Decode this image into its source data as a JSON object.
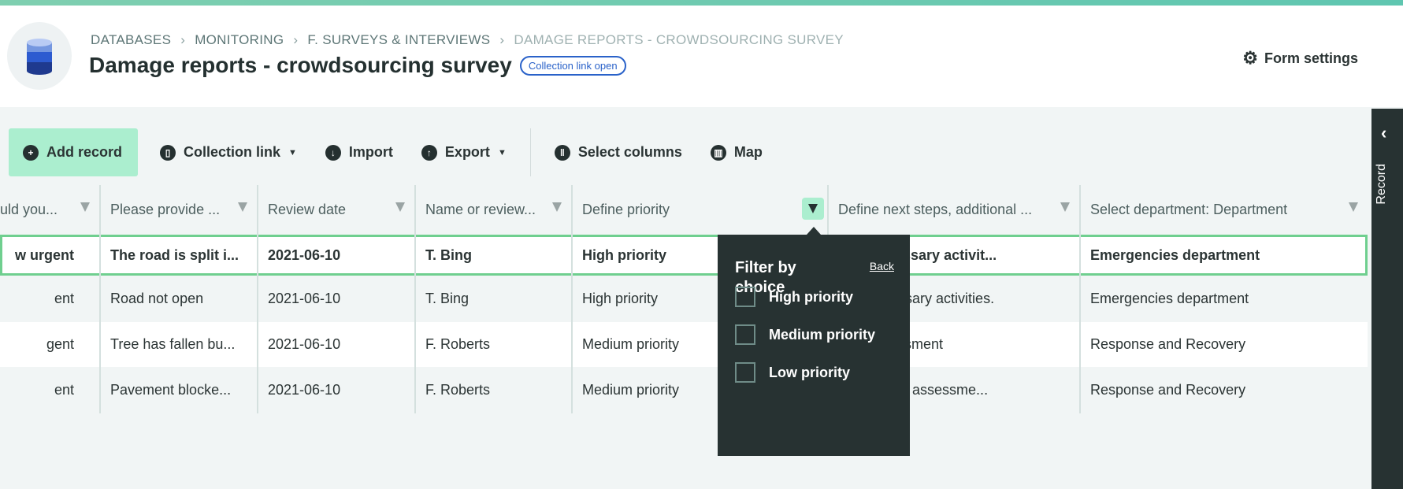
{
  "header": {
    "breadcrumbs": [
      "DATABASES",
      "MONITORING",
      "F. SURVEYS & INTERVIEWS",
      "DAMAGE REPORTS - CROWDSOURCING SURVEY"
    ],
    "title": "Damage reports - crowdsourcing survey",
    "badge": "Collection link open",
    "form_settings": "Form settings"
  },
  "toolbar": {
    "add_record": "Add record",
    "collection_link": "Collection link",
    "import": "Import",
    "export": "Export",
    "select_columns": "Select columns",
    "map": "Map"
  },
  "table": {
    "columns": [
      "uld you...",
      "Please provide ...",
      "Review date",
      "Name or review...",
      "Define priority",
      "Define next steps, additional ...",
      "Select department: Department"
    ],
    "rows": [
      [
        "w urgent",
        "The road is split i...",
        "2021-06-10",
        "T. Bing",
        "High priority",
        "with necessary activit...",
        "Emergencies department"
      ],
      [
        "ent",
        "Road not open",
        "2021-06-10",
        "T. Bing",
        "High priority",
        "with necessary activities.",
        "Emergencies department"
      ],
      [
        "gent",
        "Tree has fallen bu...",
        "2021-06-10",
        "F. Roberts",
        "Medium priority",
        "with assessment",
        "Response and Recovery"
      ],
      [
        "ent",
        "Pavement blocke...",
        "2021-06-10",
        "F. Roberts",
        "Medium priority",
        "with further assessme...",
        "Response and Recovery"
      ]
    ]
  },
  "filter_popup": {
    "title": "Filter by choice",
    "back": "Back",
    "options": [
      "High priority",
      "Medium priority",
      "Low priority"
    ]
  },
  "sidebar": {
    "label": "Record"
  },
  "colors": {
    "accent": "#abeecf",
    "selected_outline": "#6fcf8f",
    "dark": "#273232",
    "badge": "#2a62c9"
  }
}
